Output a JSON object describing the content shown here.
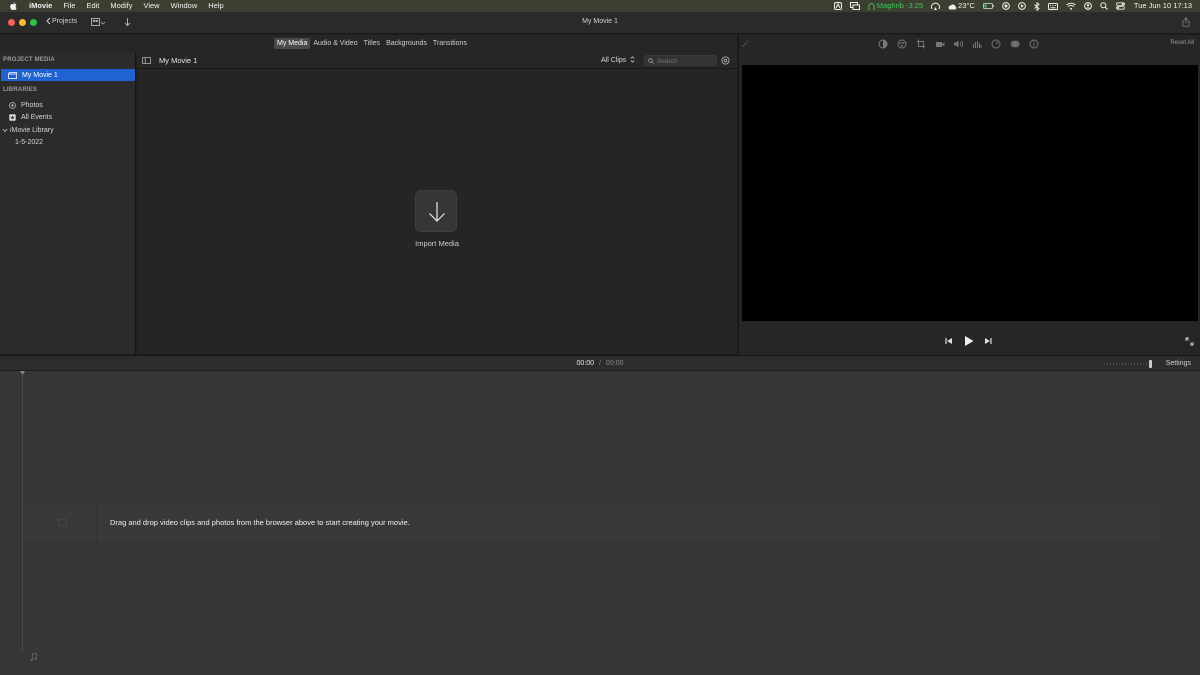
{
  "menubar": {
    "items": [
      "iMovie",
      "File",
      "Edit",
      "Modify",
      "View",
      "Window",
      "Help"
    ],
    "status": {
      "prayer": "Maghrib -3:25",
      "weather": "23°C",
      "datetime": "Tue Jun 10  17:13"
    }
  },
  "titlebar": {
    "projects_label": "Projects",
    "title": "My Movie 1"
  },
  "browser_tabs": [
    "My Media",
    "Audio & Video",
    "Titles",
    "Backgrounds",
    "Transitions"
  ],
  "sidebar": {
    "project_media_header": "PROJECT MEDIA",
    "project_item": "My Movie 1",
    "libraries_header": "LIBRARIES",
    "photos": "Photos",
    "all_events": "All Events",
    "library": "iMovie Library",
    "event": "1-5-2022"
  },
  "browser": {
    "title": "My Movie 1",
    "filter": "All Clips",
    "search_placeholder": "Search",
    "import_label": "Import Media"
  },
  "viewer": {
    "reset_all": "Reset All"
  },
  "timeline": {
    "current_time": "00:00",
    "separator": "/",
    "total_time": "00:00",
    "settings": "Settings",
    "drop_message": "Drag and drop video clips and photos from the browser above to start creating your movie."
  },
  "colors": {
    "selection": "#1f62d1",
    "menubar": "#3b3f2f",
    "status_green": "#3fc75a",
    "close": "#fe5f57",
    "minimize": "#febc2e",
    "zoom": "#28c840"
  }
}
